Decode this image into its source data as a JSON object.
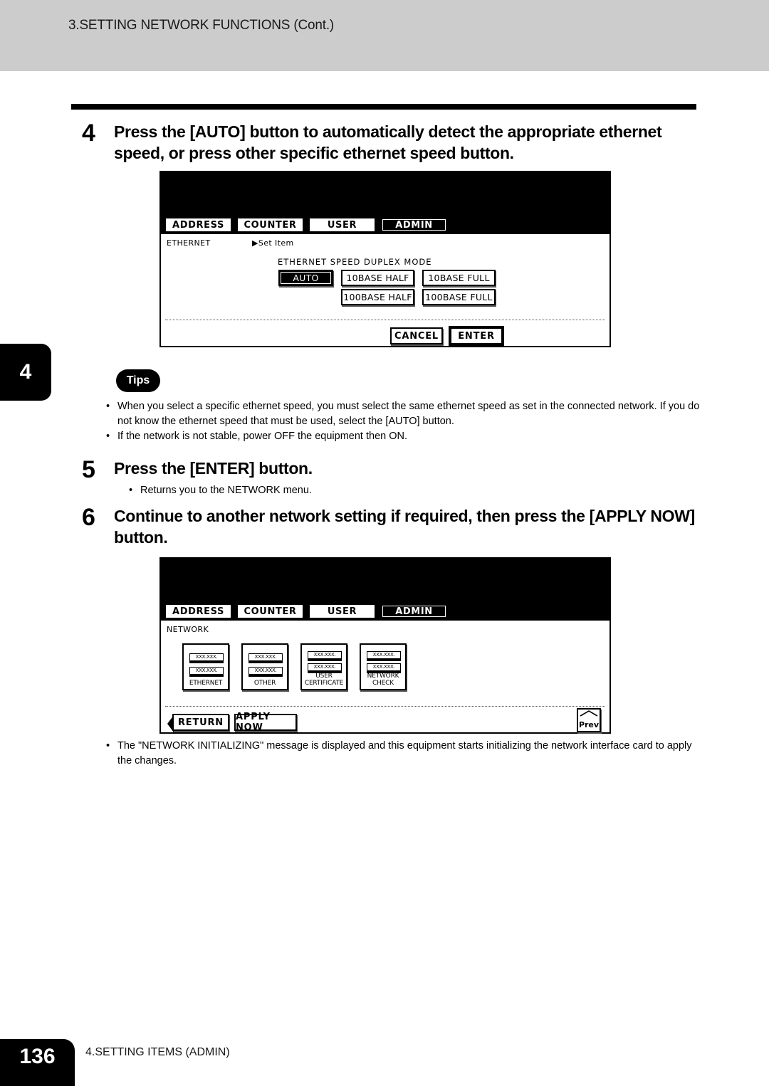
{
  "header": {
    "title": "3.SETTING NETWORK FUNCTIONS (Cont.)"
  },
  "chapter_tab": {
    "label": "4"
  },
  "steps": [
    {
      "number": "4",
      "text": "Press the [AUTO] button to automatically detect the appropriate ethernet speed, or press other specific ethernet speed button."
    },
    {
      "number": "5",
      "text": "Press the [ENTER] button.",
      "bullets": [
        "Returns you to the NETWORK menu."
      ]
    },
    {
      "number": "6",
      "text": "Continue to another network setting if required, then press the [APPLY NOW] button.",
      "bullets": [
        "The \"NETWORK INITIALIZING\" message is displayed and this equipment starts initializing the network interface card to apply the changes."
      ]
    }
  ],
  "tips": {
    "badge": "Tips",
    "bullets": [
      "When you select a specific ethernet speed, you must select the same ethernet speed as set in the connected network.  If you do not know the ethernet speed that must be used, select the [AUTO] button.",
      "If the network is not stable, power OFF the equipment then ON."
    ]
  },
  "panel1": {
    "tabs": [
      {
        "label": "ADDRESS",
        "selected": false
      },
      {
        "label": "COUNTER",
        "selected": false
      },
      {
        "label": "USER",
        "selected": false
      },
      {
        "label": "ADMIN",
        "selected": true
      }
    ],
    "screen_label": "ETHERNET",
    "breadcrumb": "Set Item",
    "group_title": "ETHERNET SPEED DUPLEX MODE",
    "speed_buttons": [
      {
        "label": "AUTO",
        "selected": true
      },
      {
        "label": "10BASE HALF",
        "selected": false
      },
      {
        "label": "10BASE FULL",
        "selected": false
      },
      {
        "label": "100BASE HALF",
        "selected": false
      },
      {
        "label": "100BASE FULL",
        "selected": false
      }
    ],
    "cancel_label": "CANCEL",
    "enter_label": "ENTER"
  },
  "panel2": {
    "tabs": [
      {
        "label": "ADDRESS",
        "selected": false
      },
      {
        "label": "COUNTER",
        "selected": false
      },
      {
        "label": "USER",
        "selected": false
      },
      {
        "label": "ADMIN",
        "selected": true
      }
    ],
    "screen_label": "NETWORK",
    "icon_value": "XXX.XXX.",
    "icons": [
      {
        "caption_line1": "ETHERNET",
        "caption_line2": ""
      },
      {
        "caption_line1": "OTHER",
        "caption_line2": ""
      },
      {
        "caption_line1": "USER",
        "caption_line2": "CERTIFICATE"
      },
      {
        "caption_line1": "NETWORK",
        "caption_line2": "CHECK"
      }
    ],
    "return_label": "RETURN",
    "apply_label": "APPLY NOW",
    "prev_label": "Prev"
  },
  "footer": {
    "page_number": "136",
    "section": "4.SETTING ITEMS (ADMIN)"
  }
}
